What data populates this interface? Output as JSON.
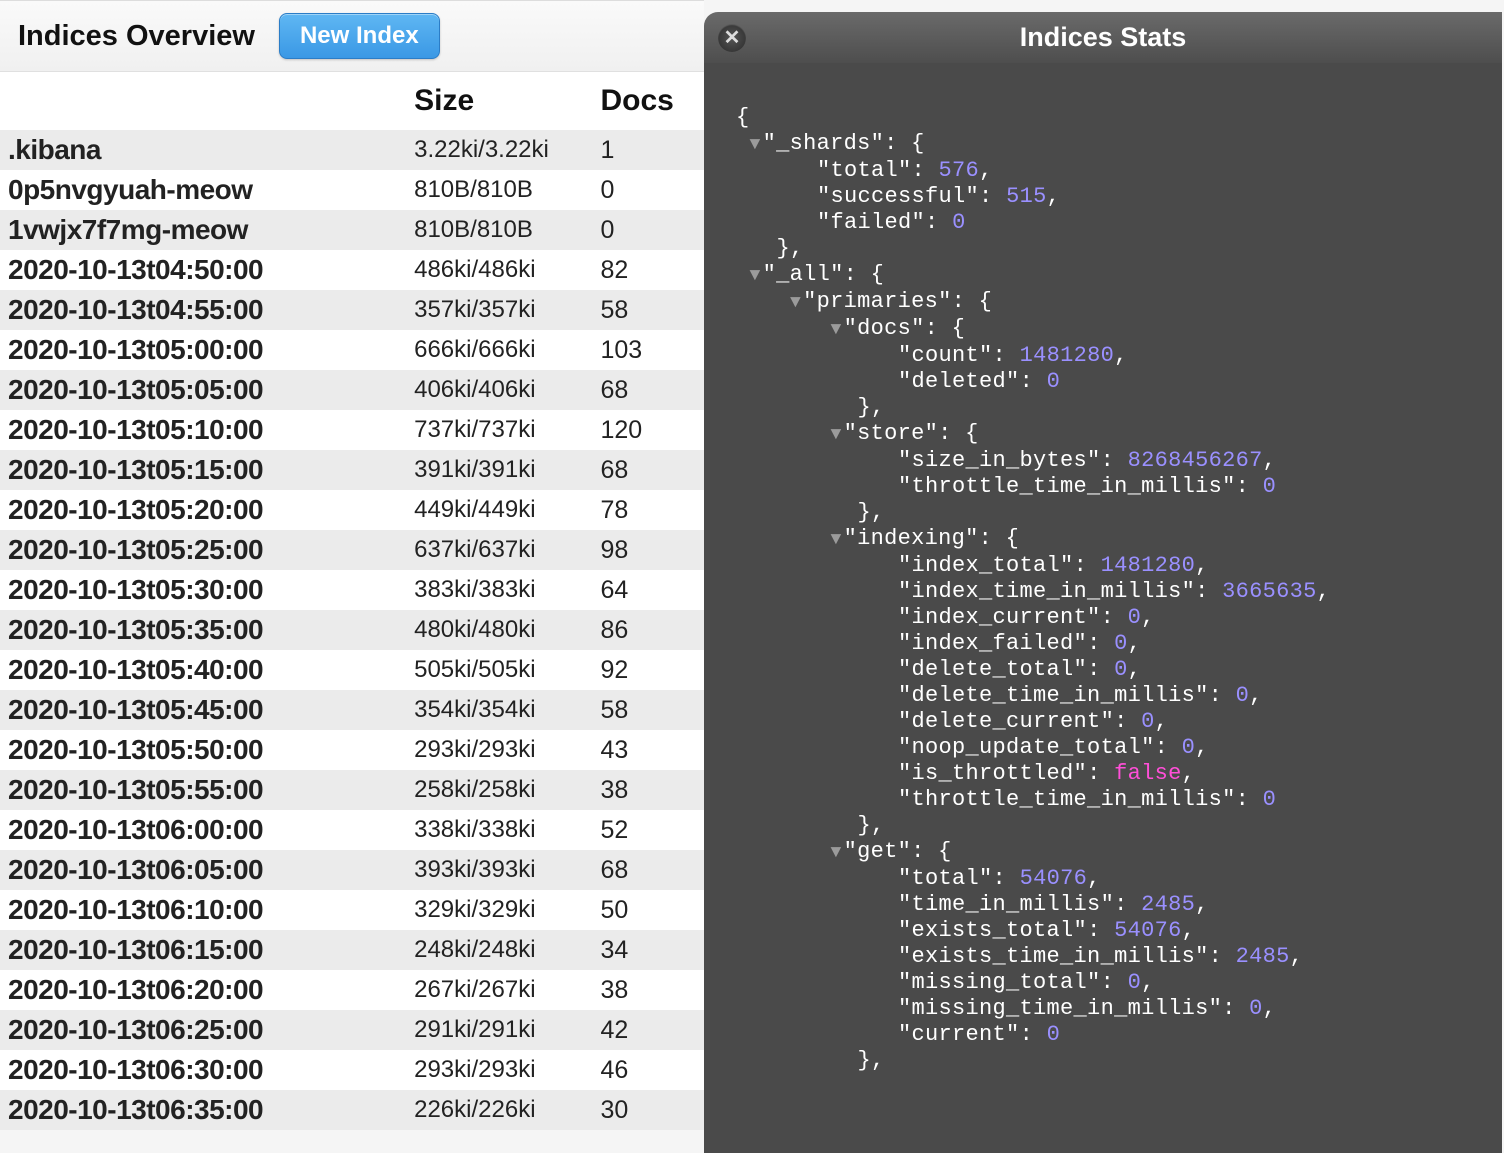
{
  "header": {
    "title": "Indices Overview",
    "new_index_label": "New Index"
  },
  "table": {
    "headers": {
      "name": "",
      "size": "Size",
      "docs": "Docs"
    },
    "rows": [
      {
        "name": ".kibana",
        "size": "3.22ki/3.22ki",
        "docs": "1"
      },
      {
        "name": "0p5nvgyuah-meow",
        "size": "810B/810B",
        "docs": "0"
      },
      {
        "name": "1vwjx7f7mg-meow",
        "size": "810B/810B",
        "docs": "0"
      },
      {
        "name": "2020-10-13t04:50:00",
        "size": "486ki/486ki",
        "docs": "82"
      },
      {
        "name": "2020-10-13t04:55:00",
        "size": "357ki/357ki",
        "docs": "58"
      },
      {
        "name": "2020-10-13t05:00:00",
        "size": "666ki/666ki",
        "docs": "103"
      },
      {
        "name": "2020-10-13t05:05:00",
        "size": "406ki/406ki",
        "docs": "68"
      },
      {
        "name": "2020-10-13t05:10:00",
        "size": "737ki/737ki",
        "docs": "120"
      },
      {
        "name": "2020-10-13t05:15:00",
        "size": "391ki/391ki",
        "docs": "68"
      },
      {
        "name": "2020-10-13t05:20:00",
        "size": "449ki/449ki",
        "docs": "78"
      },
      {
        "name": "2020-10-13t05:25:00",
        "size": "637ki/637ki",
        "docs": "98"
      },
      {
        "name": "2020-10-13t05:30:00",
        "size": "383ki/383ki",
        "docs": "64"
      },
      {
        "name": "2020-10-13t05:35:00",
        "size": "480ki/480ki",
        "docs": "86"
      },
      {
        "name": "2020-10-13t05:40:00",
        "size": "505ki/505ki",
        "docs": "92"
      },
      {
        "name": "2020-10-13t05:45:00",
        "size": "354ki/354ki",
        "docs": "58"
      },
      {
        "name": "2020-10-13t05:50:00",
        "size": "293ki/293ki",
        "docs": "43"
      },
      {
        "name": "2020-10-13t05:55:00",
        "size": "258ki/258ki",
        "docs": "38"
      },
      {
        "name": "2020-10-13t06:00:00",
        "size": "338ki/338ki",
        "docs": "52"
      },
      {
        "name": "2020-10-13t06:05:00",
        "size": "393ki/393ki",
        "docs": "68"
      },
      {
        "name": "2020-10-13t06:10:00",
        "size": "329ki/329ki",
        "docs": "50"
      },
      {
        "name": "2020-10-13t06:15:00",
        "size": "248ki/248ki",
        "docs": "34"
      },
      {
        "name": "2020-10-13t06:20:00",
        "size": "267ki/267ki",
        "docs": "38"
      },
      {
        "name": "2020-10-13t06:25:00",
        "size": "291ki/291ki",
        "docs": "42"
      },
      {
        "name": "2020-10-13t06:30:00",
        "size": "293ki/293ki",
        "docs": "46"
      },
      {
        "name": "2020-10-13t06:35:00",
        "size": "226ki/226ki",
        "docs": "30"
      }
    ]
  },
  "stats": {
    "title": "Indices Stats",
    "json_lines": [
      {
        "indent": 0,
        "tri": false,
        "text": "{"
      },
      {
        "indent": 1,
        "tri": true,
        "parts": [
          [
            "key",
            "\"_shards\""
          ],
          [
            "punct",
            ": {"
          ]
        ]
      },
      {
        "indent": 2,
        "tri": false,
        "parts": [
          [
            "key",
            "\"total\""
          ],
          [
            "punct",
            ": "
          ],
          [
            "num",
            "576"
          ],
          [
            "punct",
            ","
          ]
        ]
      },
      {
        "indent": 2,
        "tri": false,
        "parts": [
          [
            "key",
            "\"successful\""
          ],
          [
            "punct",
            ": "
          ],
          [
            "num",
            "515"
          ],
          [
            "punct",
            ","
          ]
        ]
      },
      {
        "indent": 2,
        "tri": false,
        "parts": [
          [
            "key",
            "\"failed\""
          ],
          [
            "punct",
            ": "
          ],
          [
            "num",
            "0"
          ]
        ]
      },
      {
        "indent": 1,
        "tri": false,
        "text": "},"
      },
      {
        "indent": 1,
        "tri": true,
        "parts": [
          [
            "key",
            "\"_all\""
          ],
          [
            "punct",
            ": {"
          ]
        ]
      },
      {
        "indent": 2,
        "tri": true,
        "parts": [
          [
            "key",
            "\"primaries\""
          ],
          [
            "punct",
            ": {"
          ]
        ]
      },
      {
        "indent": 3,
        "tri": true,
        "parts": [
          [
            "key",
            "\"docs\""
          ],
          [
            "punct",
            ": {"
          ]
        ]
      },
      {
        "indent": 4,
        "tri": false,
        "parts": [
          [
            "key",
            "\"count\""
          ],
          [
            "punct",
            ": "
          ],
          [
            "num",
            "1481280"
          ],
          [
            "punct",
            ","
          ]
        ]
      },
      {
        "indent": 4,
        "tri": false,
        "parts": [
          [
            "key",
            "\"deleted\""
          ],
          [
            "punct",
            ": "
          ],
          [
            "num",
            "0"
          ]
        ]
      },
      {
        "indent": 3,
        "tri": false,
        "text": "},"
      },
      {
        "indent": 3,
        "tri": true,
        "parts": [
          [
            "key",
            "\"store\""
          ],
          [
            "punct",
            ": {"
          ]
        ]
      },
      {
        "indent": 4,
        "tri": false,
        "parts": [
          [
            "key",
            "\"size_in_bytes\""
          ],
          [
            "punct",
            ": "
          ],
          [
            "num",
            "8268456267"
          ],
          [
            "punct",
            ","
          ]
        ]
      },
      {
        "indent": 4,
        "tri": false,
        "parts": [
          [
            "key",
            "\"throttle_time_in_millis\""
          ],
          [
            "punct",
            ": "
          ],
          [
            "num",
            "0"
          ]
        ]
      },
      {
        "indent": 3,
        "tri": false,
        "text": "},"
      },
      {
        "indent": 3,
        "tri": true,
        "parts": [
          [
            "key",
            "\"indexing\""
          ],
          [
            "punct",
            ": {"
          ]
        ]
      },
      {
        "indent": 4,
        "tri": false,
        "parts": [
          [
            "key",
            "\"index_total\""
          ],
          [
            "punct",
            ": "
          ],
          [
            "num",
            "1481280"
          ],
          [
            "punct",
            ","
          ]
        ]
      },
      {
        "indent": 4,
        "tri": false,
        "parts": [
          [
            "key",
            "\"index_time_in_millis\""
          ],
          [
            "punct",
            ": "
          ],
          [
            "num",
            "3665635"
          ],
          [
            "punct",
            ","
          ]
        ]
      },
      {
        "indent": 4,
        "tri": false,
        "parts": [
          [
            "key",
            "\"index_current\""
          ],
          [
            "punct",
            ": "
          ],
          [
            "num",
            "0"
          ],
          [
            "punct",
            ","
          ]
        ]
      },
      {
        "indent": 4,
        "tri": false,
        "parts": [
          [
            "key",
            "\"index_failed\""
          ],
          [
            "punct",
            ": "
          ],
          [
            "num",
            "0"
          ],
          [
            "punct",
            ","
          ]
        ]
      },
      {
        "indent": 4,
        "tri": false,
        "parts": [
          [
            "key",
            "\"delete_total\""
          ],
          [
            "punct",
            ": "
          ],
          [
            "num",
            "0"
          ],
          [
            "punct",
            ","
          ]
        ]
      },
      {
        "indent": 4,
        "tri": false,
        "parts": [
          [
            "key",
            "\"delete_time_in_millis\""
          ],
          [
            "punct",
            ": "
          ],
          [
            "num",
            "0"
          ],
          [
            "punct",
            ","
          ]
        ]
      },
      {
        "indent": 4,
        "tri": false,
        "parts": [
          [
            "key",
            "\"delete_current\""
          ],
          [
            "punct",
            ": "
          ],
          [
            "num",
            "0"
          ],
          [
            "punct",
            ","
          ]
        ]
      },
      {
        "indent": 4,
        "tri": false,
        "parts": [
          [
            "key",
            "\"noop_update_total\""
          ],
          [
            "punct",
            ": "
          ],
          [
            "num",
            "0"
          ],
          [
            "punct",
            ","
          ]
        ]
      },
      {
        "indent": 4,
        "tri": false,
        "parts": [
          [
            "key",
            "\"is_throttled\""
          ],
          [
            "punct",
            ": "
          ],
          [
            "bool",
            "false"
          ],
          [
            "punct",
            ","
          ]
        ]
      },
      {
        "indent": 4,
        "tri": false,
        "parts": [
          [
            "key",
            "\"throttle_time_in_millis\""
          ],
          [
            "punct",
            ": "
          ],
          [
            "num",
            "0"
          ]
        ]
      },
      {
        "indent": 3,
        "tri": false,
        "text": "},"
      },
      {
        "indent": 3,
        "tri": true,
        "parts": [
          [
            "key",
            "\"get\""
          ],
          [
            "punct",
            ": {"
          ]
        ]
      },
      {
        "indent": 4,
        "tri": false,
        "parts": [
          [
            "key",
            "\"total\""
          ],
          [
            "punct",
            ": "
          ],
          [
            "num",
            "54076"
          ],
          [
            "punct",
            ","
          ]
        ]
      },
      {
        "indent": 4,
        "tri": false,
        "parts": [
          [
            "key",
            "\"time_in_millis\""
          ],
          [
            "punct",
            ": "
          ],
          [
            "num",
            "2485"
          ],
          [
            "punct",
            ","
          ]
        ]
      },
      {
        "indent": 4,
        "tri": false,
        "parts": [
          [
            "key",
            "\"exists_total\""
          ],
          [
            "punct",
            ": "
          ],
          [
            "num",
            "54076"
          ],
          [
            "punct",
            ","
          ]
        ]
      },
      {
        "indent": 4,
        "tri": false,
        "parts": [
          [
            "key",
            "\"exists_time_in_millis\""
          ],
          [
            "punct",
            ": "
          ],
          [
            "num",
            "2485"
          ],
          [
            "punct",
            ","
          ]
        ]
      },
      {
        "indent": 4,
        "tri": false,
        "parts": [
          [
            "key",
            "\"missing_total\""
          ],
          [
            "punct",
            ": "
          ],
          [
            "num",
            "0"
          ],
          [
            "punct",
            ","
          ]
        ]
      },
      {
        "indent": 4,
        "tri": false,
        "parts": [
          [
            "key",
            "\"missing_time_in_millis\""
          ],
          [
            "punct",
            ": "
          ],
          [
            "num",
            "0"
          ],
          [
            "punct",
            ","
          ]
        ]
      },
      {
        "indent": 4,
        "tri": false,
        "parts": [
          [
            "key",
            "\"current\""
          ],
          [
            "punct",
            ": "
          ],
          [
            "num",
            "0"
          ]
        ]
      },
      {
        "indent": 3,
        "tri": false,
        "text": "},"
      }
    ]
  }
}
